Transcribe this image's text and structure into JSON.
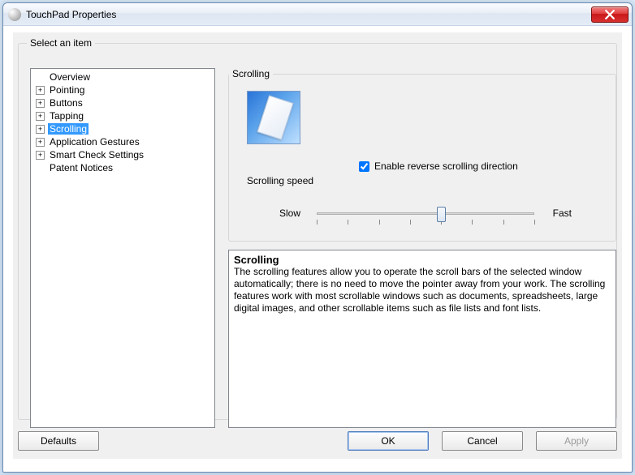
{
  "window": {
    "title": "TouchPad Properties"
  },
  "outer_legend": "Select an item",
  "tree": {
    "items": [
      {
        "label": "Overview",
        "expandable": false
      },
      {
        "label": "Pointing",
        "expandable": true
      },
      {
        "label": "Buttons",
        "expandable": true
      },
      {
        "label": "Tapping",
        "expandable": true
      },
      {
        "label": "Scrolling",
        "expandable": true,
        "selected": true
      },
      {
        "label": "Application Gestures",
        "expandable": true
      },
      {
        "label": "Smart Check Settings",
        "expandable": true
      },
      {
        "label": "Patent Notices",
        "expandable": false
      }
    ]
  },
  "scrolling": {
    "legend": "Scrolling",
    "reverse_checkbox": "Enable reverse scrolling direction",
    "reverse_checked": true,
    "speed_label": "Scrolling speed",
    "slow": "Slow",
    "fast": "Fast",
    "slider_ticks": 8,
    "slider_value": 4
  },
  "description": {
    "title": "Scrolling",
    "body": "The scrolling features allow you to operate the scroll bars of the selected window automatically; there is no need to move the pointer away from your work. The scrolling features work with most scrollable windows such as documents, spreadsheets, large digital images, and other scrollable items such as file lists and font lists."
  },
  "buttons": {
    "defaults": "Defaults",
    "ok": "OK",
    "cancel": "Cancel",
    "apply": "Apply"
  }
}
